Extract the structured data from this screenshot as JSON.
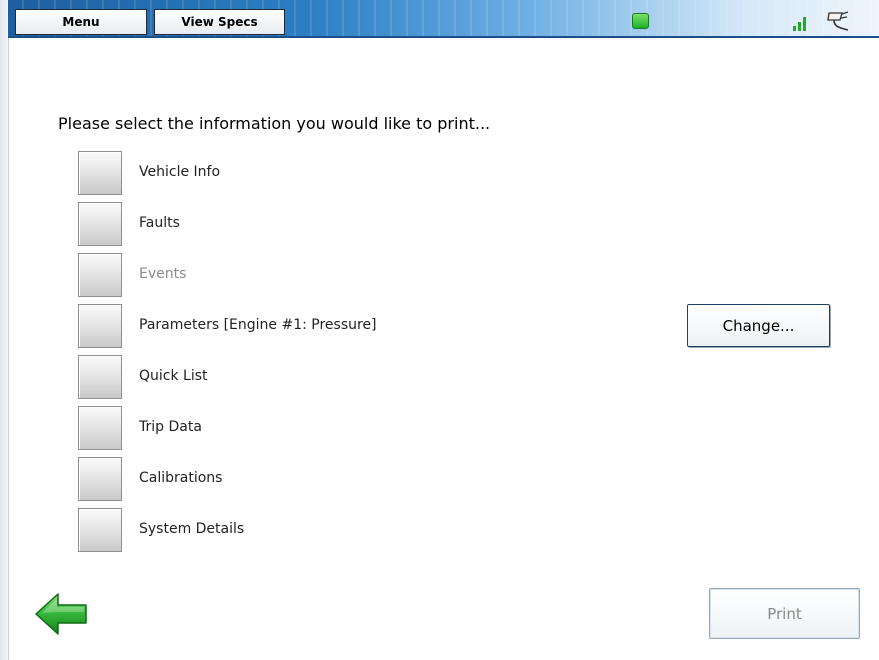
{
  "toolbar": {
    "menu_label": "Menu",
    "view_specs_label": "View Specs",
    "status_icon": "status-led-icon",
    "signal_icon": "signal-strength-icon",
    "connector_icon": "connector-cable-icon",
    "status_color": "#22aa22"
  },
  "main": {
    "prompt": "Please select the information you would like to print...",
    "options": [
      {
        "label": "Vehicle Info",
        "enabled": true,
        "checked": false
      },
      {
        "label": "Faults",
        "enabled": true,
        "checked": false
      },
      {
        "label": "Events",
        "enabled": false,
        "checked": false
      },
      {
        "label": "Parameters [Engine #1: Pressure]",
        "enabled": true,
        "checked": false
      },
      {
        "label": "Quick List",
        "enabled": true,
        "checked": false
      },
      {
        "label": "Trip Data",
        "enabled": true,
        "checked": false
      },
      {
        "label": "Calibrations",
        "enabled": true,
        "checked": false
      },
      {
        "label": "System Details",
        "enabled": true,
        "checked": false
      }
    ],
    "change_label": "Change..."
  },
  "footer": {
    "back_icon": "back-arrow-icon",
    "print_label": "Print",
    "print_enabled": false
  }
}
